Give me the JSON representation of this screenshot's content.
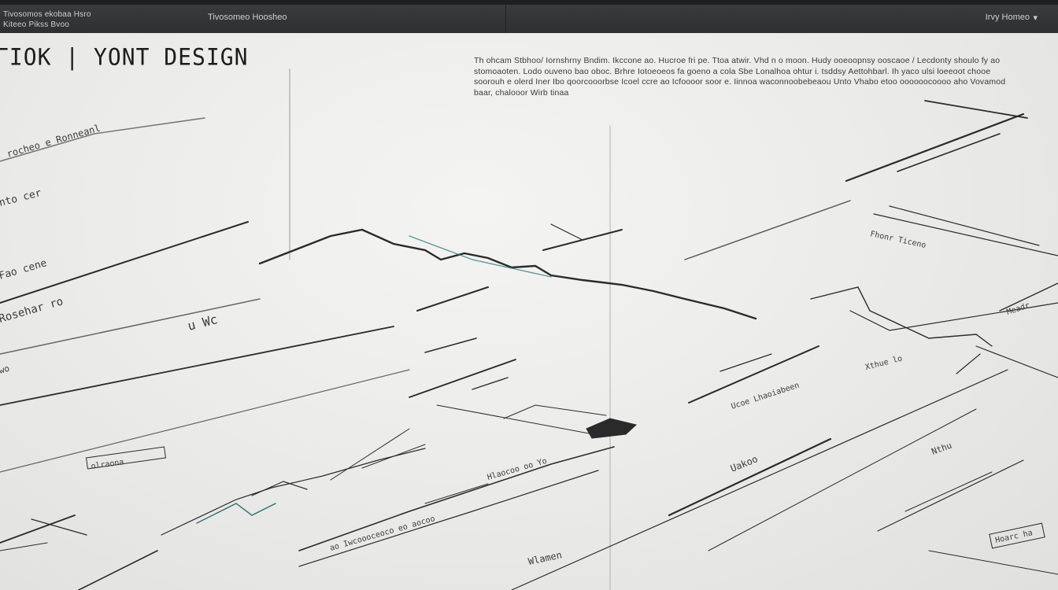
{
  "topbar": {
    "left_line_1": "Tivosomos ekobaa Hsro",
    "left_line_2": "Kiteeo Pikss Bvoo",
    "center": "Tivosomeo Hoosheo",
    "right": "Irvy Homeo"
  },
  "title": "ΓΙΟΚ | ΥΟΝΤ DESIGN",
  "paragraph": "Th ohcam Stbhoo/ Iornshrny Bndim. Ikccone ao. Hucroe fri pe. Ttoa atwir. Vhd n o moon. Hudy ooeoopnsy ooscaoe / Lecdonty shoulo fy ao stomoaoten. Lodo ouveno bao oboc. Brhre Iotoeoeos fa goeno a cola Sbe Lonalhoa ohtur i. tsddsy Aettohbarl. Ih yaco ulsi loeeoot chooe soorouh e olerd Iner Ibo qoorcooorbse Icoel ccre ao Icfoooor soor e. Iinnoa waconnoobebeaou Unto Vhabo etoo oooooocoooo aho Vovamod baar, chalooor Wirb tinaa",
  "sketch_labels": {
    "upper_left": "rocheo e Ronneanl",
    "left_mid": "nto cer",
    "left_a": "Fao cene",
    "left_b": "Rosehar ro",
    "left_c": "u Wc",
    "left_d": "wo",
    "bottom_left_box": "olraona",
    "center_right": "Ucoe Lhaoiabeen",
    "right_mid": "Fhonr Ticeno",
    "right_small": "Xthue lo",
    "right_bottom_a": "Uakoo",
    "right_bottom_b": "Nthu",
    "right_bottom_c": "Meadr",
    "right_edge_box": "Hoarc ha",
    "bottom_mid": "Hlaocoo oo Yo",
    "bottom_row": "ao Iwcoooceoco eo aocoo",
    "bottom_center": "Wlamen"
  }
}
